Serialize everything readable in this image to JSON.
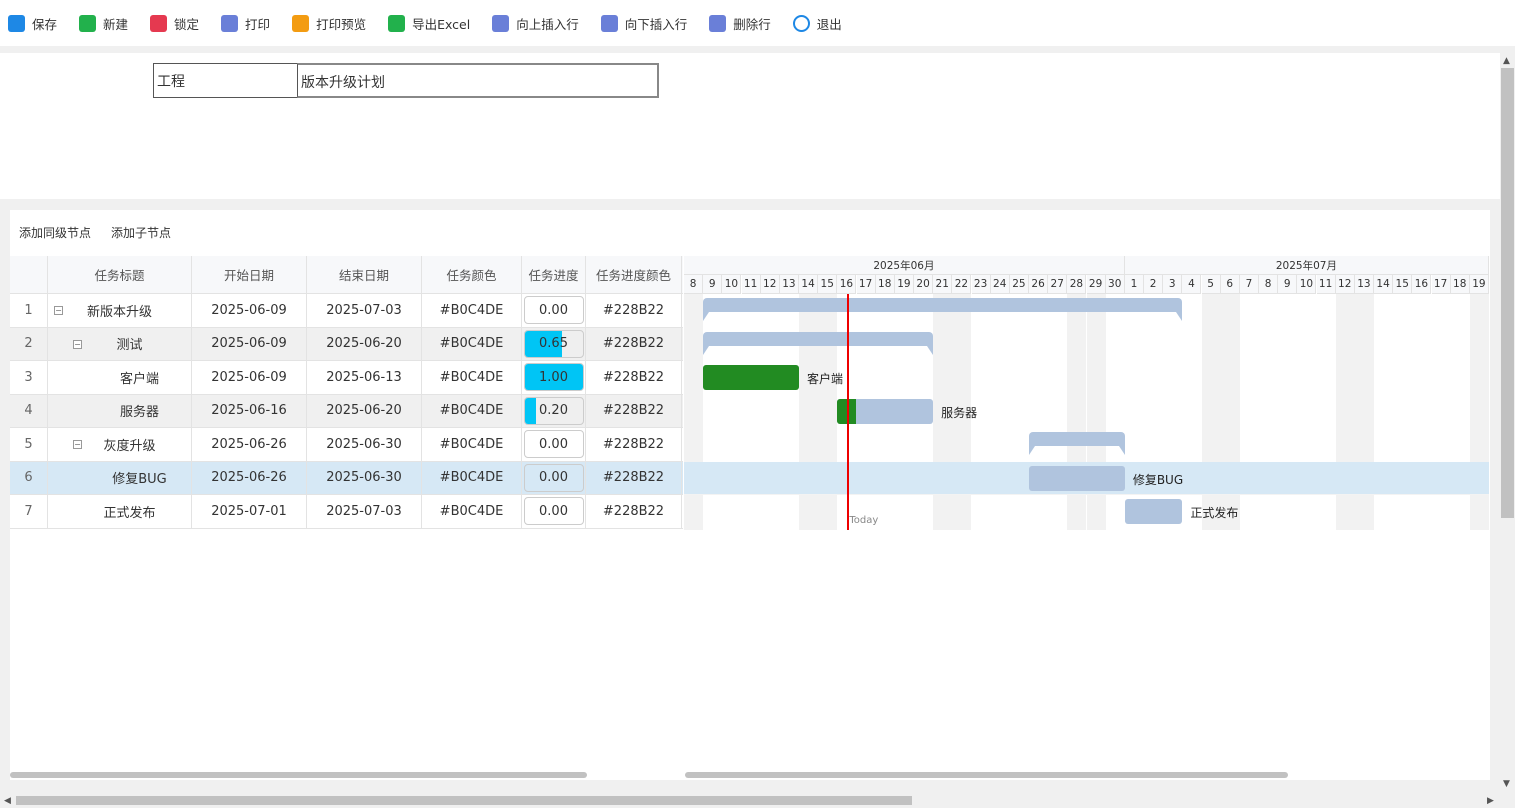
{
  "toolbar": [
    {
      "label": "保存",
      "icon": "save-icon",
      "color": "#1e88e5"
    },
    {
      "label": "新建",
      "icon": "new-icon",
      "color": "#22b14c"
    },
    {
      "label": "锁定",
      "icon": "lock-icon",
      "color": "#e53950"
    },
    {
      "label": "打印",
      "icon": "print-icon",
      "color": "#6a7fd8"
    },
    {
      "label": "打印预览",
      "icon": "print-preview-icon",
      "color": "#f39c12"
    },
    {
      "label": "导出Excel",
      "icon": "excel-icon",
      "color": "#22b14c"
    },
    {
      "label": "向上插入行",
      "icon": "insert-above-icon",
      "color": "#6a7fd8"
    },
    {
      "label": "向下插入行",
      "icon": "insert-below-icon",
      "color": "#6a7fd8"
    },
    {
      "label": "删除行",
      "icon": "delete-row-icon",
      "color": "#6a7fd8"
    },
    {
      "label": "退出",
      "icon": "power-icon",
      "color": "#1e88e5"
    }
  ],
  "project": {
    "label": "工程",
    "value": "版本升级计划"
  },
  "actions": {
    "add_sibling": "添加同级节点",
    "add_child": "添加子节点"
  },
  "columns": [
    "",
    "任务标题",
    "开始日期",
    "结束日期",
    "任务颜色",
    "任务进度",
    "任务进度颜色"
  ],
  "tasks": [
    {
      "num": "1",
      "title": "新版本升级",
      "start": "2025-06-09",
      "end": "2025-07-03",
      "color": "#B0C4DE",
      "progress": "0.00",
      "pcolor": "#228B22",
      "level": 0,
      "summary": true,
      "s": 1,
      "e": 25
    },
    {
      "num": "2",
      "title": "测试",
      "start": "2025-06-09",
      "end": "2025-06-20",
      "color": "#B0C4DE",
      "progress": "0.65",
      "pcolor": "#228B22",
      "level": 1,
      "summary": true,
      "s": 1,
      "e": 12
    },
    {
      "num": "3",
      "title": "客户端",
      "start": "2025-06-09",
      "end": "2025-06-13",
      "color": "#B0C4DE",
      "progress": "1.00",
      "pcolor": "#228B22",
      "level": 2,
      "summary": false,
      "s": 1,
      "e": 5
    },
    {
      "num": "4",
      "title": "服务器",
      "start": "2025-06-16",
      "end": "2025-06-20",
      "color": "#B0C4DE",
      "progress": "0.20",
      "pcolor": "#228B22",
      "level": 2,
      "summary": false,
      "s": 8,
      "e": 12
    },
    {
      "num": "5",
      "title": "灰度升级",
      "start": "2025-06-26",
      "end": "2025-06-30",
      "color": "#B0C4DE",
      "progress": "0.00",
      "pcolor": "#228B22",
      "level": 1,
      "summary": true,
      "s": 18,
      "e": 22
    },
    {
      "num": "6",
      "title": "修复BUG",
      "start": "2025-06-26",
      "end": "2025-06-30",
      "color": "#B0C4DE",
      "progress": "0.00",
      "pcolor": "#228B22",
      "level": 2,
      "summary": false,
      "s": 18,
      "e": 22
    },
    {
      "num": "7",
      "title": "正式发布",
      "start": "2025-07-01",
      "end": "2025-07-03",
      "color": "#B0C4DE",
      "progress": "0.00",
      "pcolor": "#228B22",
      "level": 1,
      "summary": false,
      "s": 23,
      "e": 25
    }
  ],
  "timeline": {
    "months": [
      {
        "label": "2025年06月",
        "days": 23
      },
      {
        "label": "2025年07月",
        "days": 19
      }
    ],
    "days": [
      "8",
      "9",
      "10",
      "11",
      "12",
      "13",
      "14",
      "15",
      "16",
      "17",
      "18",
      "19",
      "20",
      "21",
      "22",
      "23",
      "24",
      "25",
      "26",
      "27",
      "28",
      "29",
      "30",
      "1",
      "2",
      "3",
      "4",
      "5",
      "6",
      "7",
      "8",
      "9",
      "10",
      "11",
      "12",
      "13",
      "14",
      "15",
      "16",
      "17",
      "18",
      "19"
    ],
    "weekends": [
      0,
      6,
      7,
      13,
      14,
      20,
      21,
      27,
      28,
      34,
      35,
      41
    ],
    "today_index": 8,
    "today_label": "Today"
  },
  "selected_row": 6
}
